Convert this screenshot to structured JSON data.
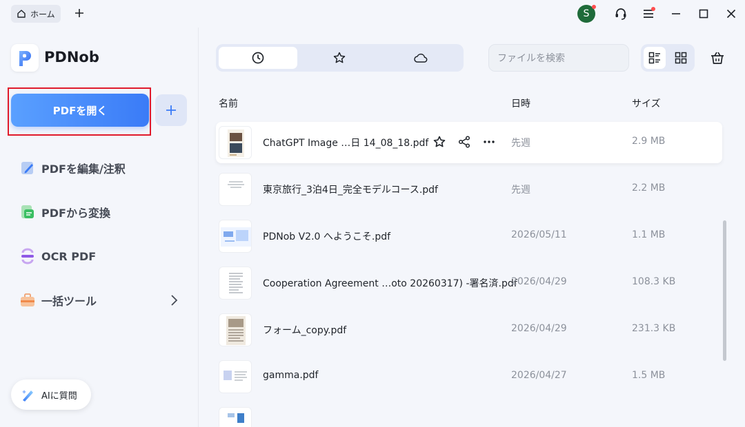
{
  "titlebar": {
    "home_tab": "ホーム",
    "avatar_letter": "S"
  },
  "sidebar": {
    "app_name": "PDNob",
    "open_button": "PDFを開く",
    "items": [
      {
        "label": "PDFを編集/注釈",
        "icon": "edit-icon"
      },
      {
        "label": "PDFから変換",
        "icon": "convert-icon"
      },
      {
        "label": "OCR PDF",
        "icon": "ocr-icon"
      },
      {
        "label": "一括ツール",
        "icon": "toolbox-icon"
      }
    ],
    "ai_button": "AIに質問"
  },
  "main": {
    "tabs": [
      {
        "icon": "recent-clock-icon",
        "active": true
      },
      {
        "icon": "star-icon",
        "active": false
      },
      {
        "icon": "cloud-icon",
        "active": false
      }
    ],
    "search_placeholder": "ファイルを検索",
    "columns": {
      "name": "名前",
      "date": "日時",
      "size": "サイズ"
    },
    "files": [
      {
        "name": "ChatGPT Image …日 14_08_18.pdf",
        "date": "先週",
        "size": "2.9 MB"
      },
      {
        "name": "東京旅行_3泊4日_完全モデルコース.pdf",
        "date": "先週",
        "size": "2.2 MB"
      },
      {
        "name": "PDNob V2.0 へようこそ.pdf",
        "date": "2026/05/11",
        "size": "1.1 MB"
      },
      {
        "name": "Cooperation Agreement …oto 20260317) -署名済.pdf",
        "date": "2026/04/29",
        "size": "108.3 KB"
      },
      {
        "name": "フォーム_copy.pdf",
        "date": "2026/04/29",
        "size": "231.3 KB"
      },
      {
        "name": "gamma.pdf",
        "date": "2026/04/27",
        "size": "1.5 MB"
      }
    ]
  },
  "colors": {
    "accent": "#3a7bf7",
    "highlight_border": "#e0192b",
    "avatar_bg": "#1f6b3a"
  }
}
